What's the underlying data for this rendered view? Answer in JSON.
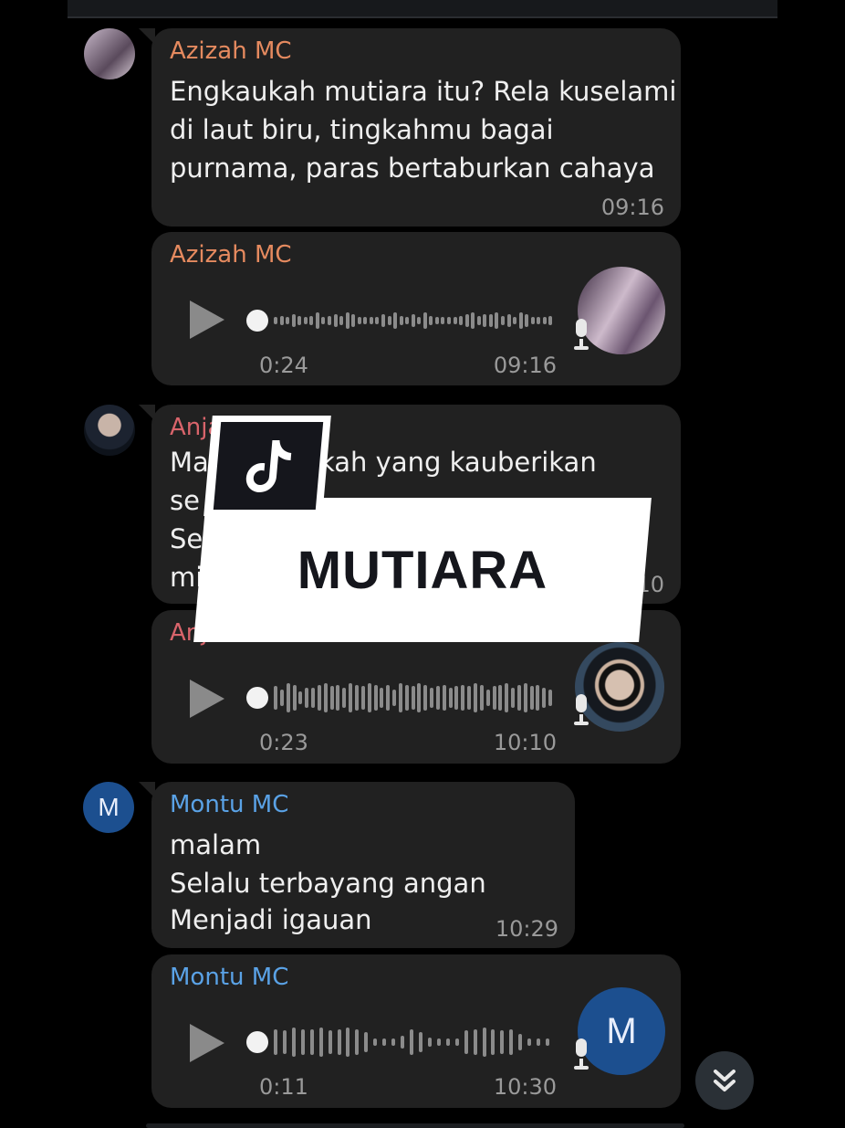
{
  "colors": {
    "azizah": "#e58a5f",
    "anjar": "#d9646b",
    "montu": "#5aa2e6",
    "bubble": "#212121",
    "accent_avatar": "#1c4f8f"
  },
  "overlay": {
    "title": "MUTIARA",
    "logo": "tiktok-logo-icon"
  },
  "messages": [
    {
      "sender": "Azizah MC",
      "lines": [
        "Engkaukah mutiara itu? Rela kuselami",
        "di laut biru, tingkahmu bagai",
        "purnama, paras bertaburkan cahaya"
      ],
      "time": "09:16"
    },
    {
      "sender": "Azizah MC",
      "voice": {
        "duration": "0:24",
        "time": "09:16"
      }
    },
    {
      "sender": "Anja",
      "lines": [
        "Ma",
        "se",
        "Sela",
        "mi"
      ],
      "lines_right": [
        "kah yang kauberikan"
      ],
      "time": ":10"
    },
    {
      "sender": "Anj",
      "voice": {
        "duration": "0:23",
        "time": "10:10"
      }
    },
    {
      "sender": "Montu MC",
      "lines": [
        "malam",
        "Selalu terbayang angan",
        "Menjadi igauan"
      ],
      "time": "10:29"
    },
    {
      "sender": "Montu MC",
      "voice": {
        "duration": "0:11",
        "time": "10:30"
      }
    }
  ],
  "avatars": {
    "montu_initial": "M"
  },
  "scroll_button": {
    "icon": "double-chevron-down-icon"
  }
}
